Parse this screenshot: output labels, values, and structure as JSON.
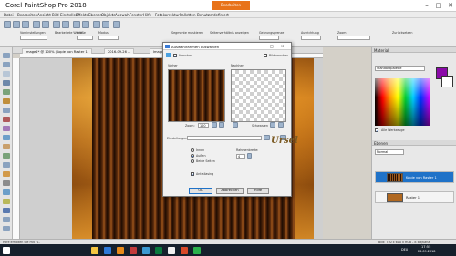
{
  "app": {
    "title": "Corel PaintShop Pro 2018",
    "workspace_tab": "Bearbeiten",
    "window_buttons": [
      "–",
      "□",
      "✕"
    ]
  },
  "menu": [
    "Datei",
    "Bearbeiten",
    "Ansicht",
    "Bild",
    "Einstellen",
    "Effekte",
    "Ebenen",
    "Objekte",
    "Auswahl",
    "Fenster",
    "Hilfe",
    "Fotokorrektur",
    "Palletten",
    "Benutzerdefiniert"
  ],
  "options": {
    "ebenen_label": "Segmente maskieren",
    "absatz_label": "Seitenverhältnis anzeigen",
    "preset_label": "Voreinstellungen",
    "bearbeitet_label": "Bearbeitete Werte",
    "groesse_label": "Größe",
    "modus_label": "Modus",
    "gehr_label": "Gehrungsgrenze",
    "ausrichtung_label": "Ausrichtung",
    "zoom_label": "Zoom",
    "reset_label": "Zurücksetzen"
  },
  "doc": {
    "tabs": [
      "Image1* @ 100% (Kopie von Raster 1)",
      "2016-09-26 ...",
      "Image2 @ 100% (Raster 1)"
    ],
    "canvas_caption": "100%"
  },
  "dialog": {
    "title": "Auswahlrahmen auswählen",
    "preview_label": "Vorschau",
    "before_label": "Vorher",
    "after_label": "Nachher",
    "bildvorschau_label": "Bildvorschau",
    "zoom_label": "Zoom:",
    "zoom_value": "100",
    "schwarzen_label": "Schwarzen",
    "settings_label": "Einstellungen:",
    "settings_value": "",
    "radio_options": [
      "Innen",
      "Außen",
      "Beide Seiten"
    ],
    "radio_selected": 1,
    "width_label": "Rahmenbreite:",
    "width_value": "4",
    "antialias_label": "Antialiasing",
    "antialias_checked": true,
    "ok_label": "OK",
    "cancel_label": "Abbrechen",
    "help_label": "Hilfe",
    "watermark": "Ursel"
  },
  "right": {
    "material_title": "Material",
    "material_preset": "Standardpalette",
    "alle_label": "Alle Werkzeuge",
    "layers_title": "Ebenen",
    "layers_blend": "Normal",
    "layers": [
      {
        "name": "Kopie von Raster 1",
        "selected": true
      },
      {
        "name": "Raster 1",
        "selected": false
      }
    ]
  },
  "status": {
    "left": "Hilfe erhalten Sie mit F1.",
    "right": "Bild: 750 x 600 x RGB - 8 Bit/Kanal"
  },
  "taskbar": {
    "time": "17:55",
    "date": "26.09.2018",
    "lang": "DEU"
  },
  "colors": {
    "accent": "#e8731a",
    "foreground_material": "#8a0aa8",
    "background_material": "#ffffff",
    "selection": "#1f72c8"
  }
}
